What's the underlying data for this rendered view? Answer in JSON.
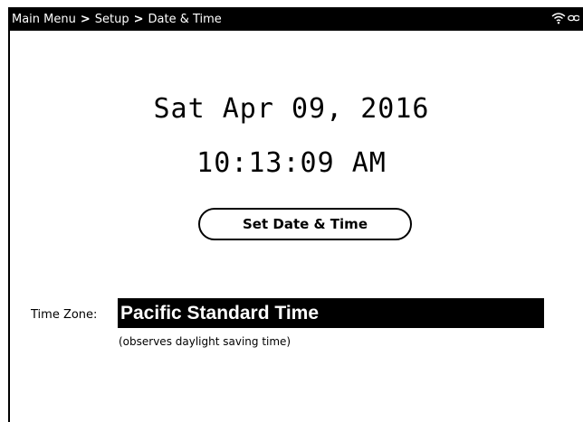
{
  "breadcrumb": {
    "items": [
      "Main Menu",
      "Setup",
      "Date & Time"
    ],
    "separator": ">"
  },
  "status": {
    "icons": [
      "wifi-icon",
      "link-icon"
    ]
  },
  "datetime": {
    "date": "Sat Apr 09, 2016",
    "time": "10:13:09 AM"
  },
  "actions": {
    "set_date_time_label": "Set Date & Time"
  },
  "timezone": {
    "label": "Time Zone:",
    "value": "Pacific Standard Time",
    "note": "(observes daylight saving time)"
  },
  "colors": {
    "background": "#ffffff",
    "foreground": "#000000"
  }
}
